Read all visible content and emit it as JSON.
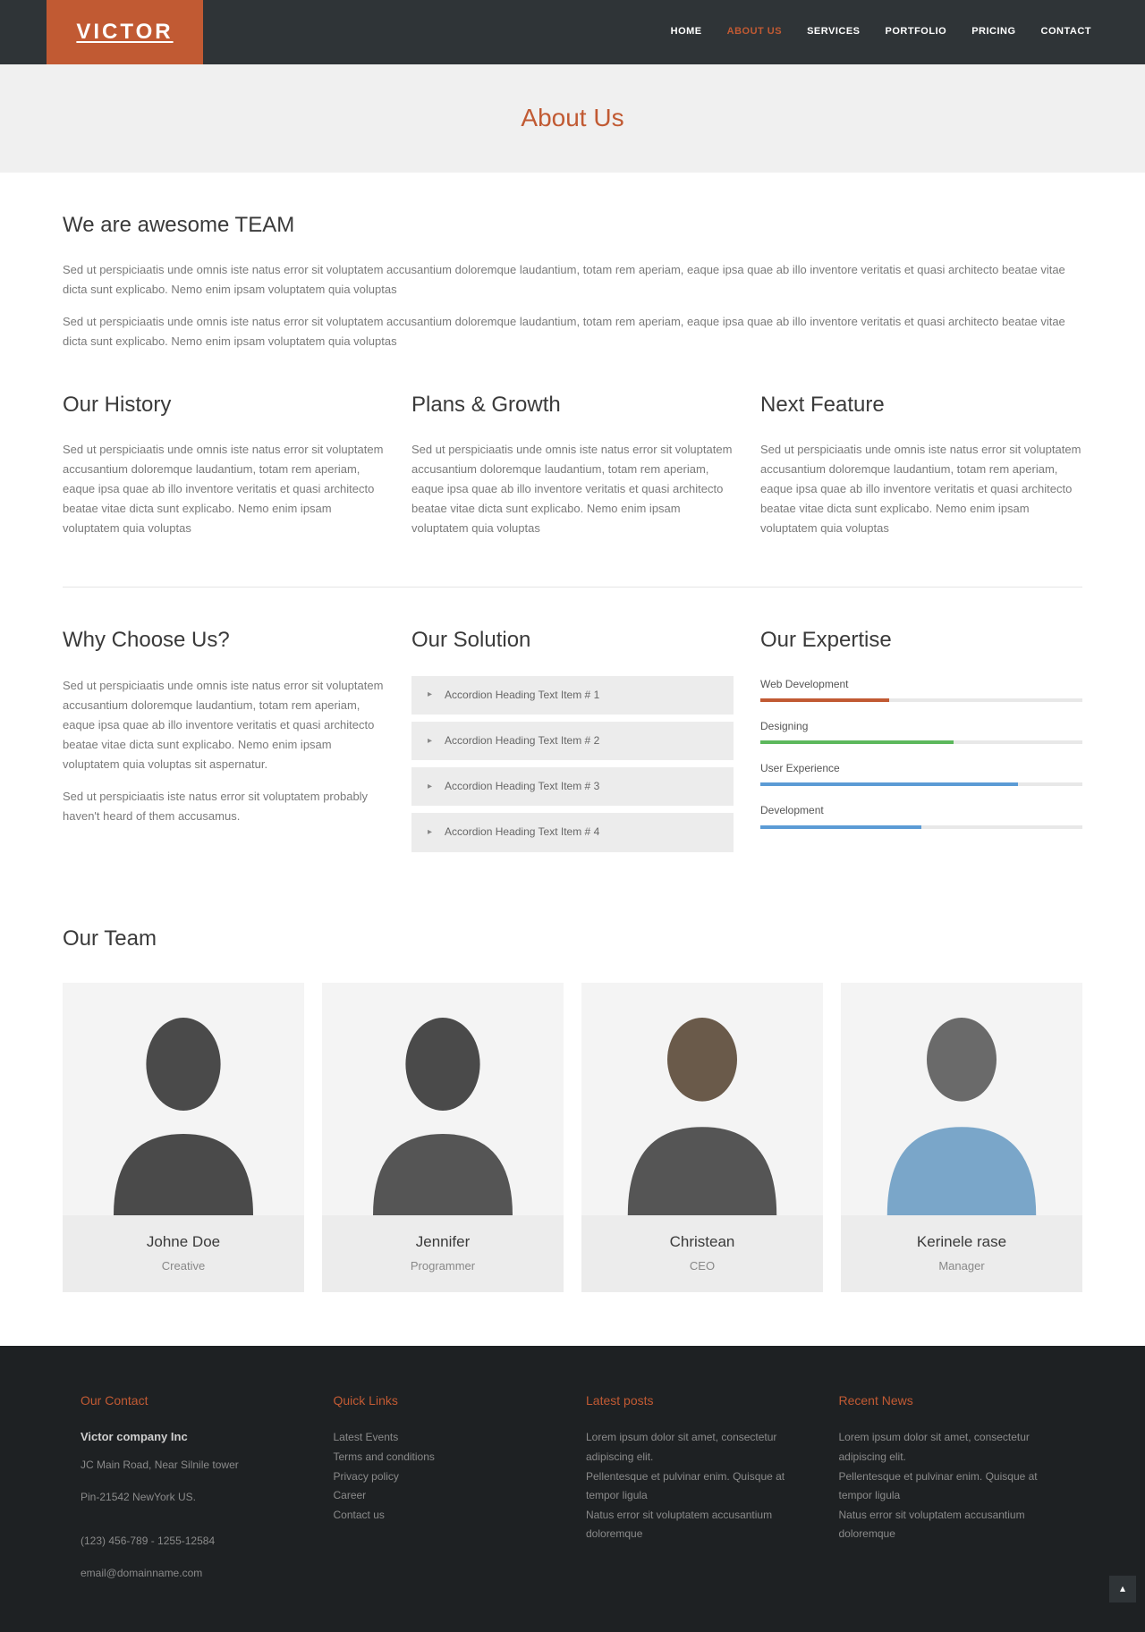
{
  "logo": "VICTOR",
  "nav": [
    {
      "label": "HOME",
      "active": false
    },
    {
      "label": "ABOUT US",
      "active": true
    },
    {
      "label": "SERVICES",
      "active": false
    },
    {
      "label": "PORTFOLIO",
      "active": false
    },
    {
      "label": "PRICING",
      "active": false
    },
    {
      "label": "CONTACT",
      "active": false
    }
  ],
  "page_title": "About Us",
  "intro": {
    "heading": "We are awesome TEAM",
    "p1": "Sed ut perspiciaatis unde omnis iste natus error sit voluptatem accusantium doloremque laudantium, totam rem aperiam, eaque ipsa quae ab illo inventore veritatis et quasi architecto beatae vitae dicta sunt explicabo. Nemo enim ipsam voluptatem quia voluptas",
    "p2": "Sed ut perspiciaatis unde omnis iste natus error sit voluptatem accusantium doloremque laudantium, totam rem aperiam, eaque ipsa quae ab illo inventore veritatis et quasi architecto beatae vitae dicta sunt explicabo. Nemo enim ipsam voluptatem quia voluptas"
  },
  "columns": [
    {
      "heading": "Our History",
      "text": "Sed ut perspiciaatis unde omnis iste natus error sit voluptatem accusantium doloremque laudantium, totam rem aperiam, eaque ipsa quae ab illo inventore veritatis et quasi architecto beatae vitae dicta sunt explicabo. Nemo enim ipsam voluptatem quia voluptas"
    },
    {
      "heading": "Plans & Growth",
      "text": "Sed ut perspiciaatis unde omnis iste natus error sit voluptatem accusantium doloremque laudantium, totam rem aperiam, eaque ipsa quae ab illo inventore veritatis et quasi architecto beatae vitae dicta sunt explicabo. Nemo enim ipsam voluptatem quia voluptas"
    },
    {
      "heading": "Next Feature",
      "text": "Sed ut perspiciaatis unde omnis iste natus error sit voluptatem accusantium doloremque laudantium, totam rem aperiam, eaque ipsa quae ab illo inventore veritatis et quasi architecto beatae vitae dicta sunt explicabo. Nemo enim ipsam voluptatem quia voluptas"
    }
  ],
  "why": {
    "heading": "Why Choose Us?",
    "p1": "Sed ut perspiciaatis unde omnis iste natus error sit voluptatem accusantium doloremque laudantium, totam rem aperiam, eaque ipsa quae ab illo inventore veritatis et quasi architecto beatae vitae dicta sunt explicabo. Nemo enim ipsam voluptatem quia voluptas sit aspernatur.",
    "p2": "Sed ut perspiciaatis iste natus error sit voluptatem probably haven't heard of them accusamus."
  },
  "solution": {
    "heading": "Our Solution",
    "items": [
      "Accordion Heading Text Item # 1",
      "Accordion Heading Text Item # 2",
      "Accordion Heading Text Item # 3",
      "Accordion Heading Text Item # 4"
    ]
  },
  "expertise": {
    "heading": "Our Expertise",
    "skills": [
      {
        "label": "Web Development",
        "value": 40,
        "color": "#c15a33"
      },
      {
        "label": "Designing",
        "value": 60,
        "color": "#5cb85c"
      },
      {
        "label": "User Experience",
        "value": 80,
        "color": "#5b9bd5"
      },
      {
        "label": "Development",
        "value": 50,
        "color": "#5b9bd5"
      }
    ]
  },
  "team": {
    "heading": "Our Team",
    "members": [
      {
        "name": "Johne Doe",
        "role": "Creative"
      },
      {
        "name": "Jennifer",
        "role": "Programmer"
      },
      {
        "name": "Christean",
        "role": "CEO"
      },
      {
        "name": "Kerinele rase",
        "role": "Manager"
      }
    ]
  },
  "footer": {
    "contact": {
      "heading": "Our Contact",
      "company": "Victor company Inc",
      "addr1": "JC Main Road, Near Silnile tower",
      "addr2": "Pin-21542 NewYork US.",
      "phone": "(123) 456-789 - 1255-12584",
      "email": "email@domainname.com"
    },
    "quick": {
      "heading": "Quick Links",
      "links": [
        "Latest Events",
        "Terms and conditions",
        "Privacy policy",
        "Career",
        "Contact us"
      ]
    },
    "latest": {
      "heading": "Latest posts",
      "items": [
        "Lorem ipsum dolor sit amet, consectetur adipiscing elit.",
        "Pellentesque et pulvinar enim. Quisque at tempor ligula",
        "Natus error sit voluptatem accusantium doloremque"
      ]
    },
    "recent": {
      "heading": "Recent News",
      "items": [
        "Lorem ipsum dolor sit amet, consectetur adipiscing elit.",
        "Pellentesque et pulvinar enim. Quisque at tempor ligula",
        "Natus error sit voluptatem accusantium doloremque"
      ]
    }
  }
}
